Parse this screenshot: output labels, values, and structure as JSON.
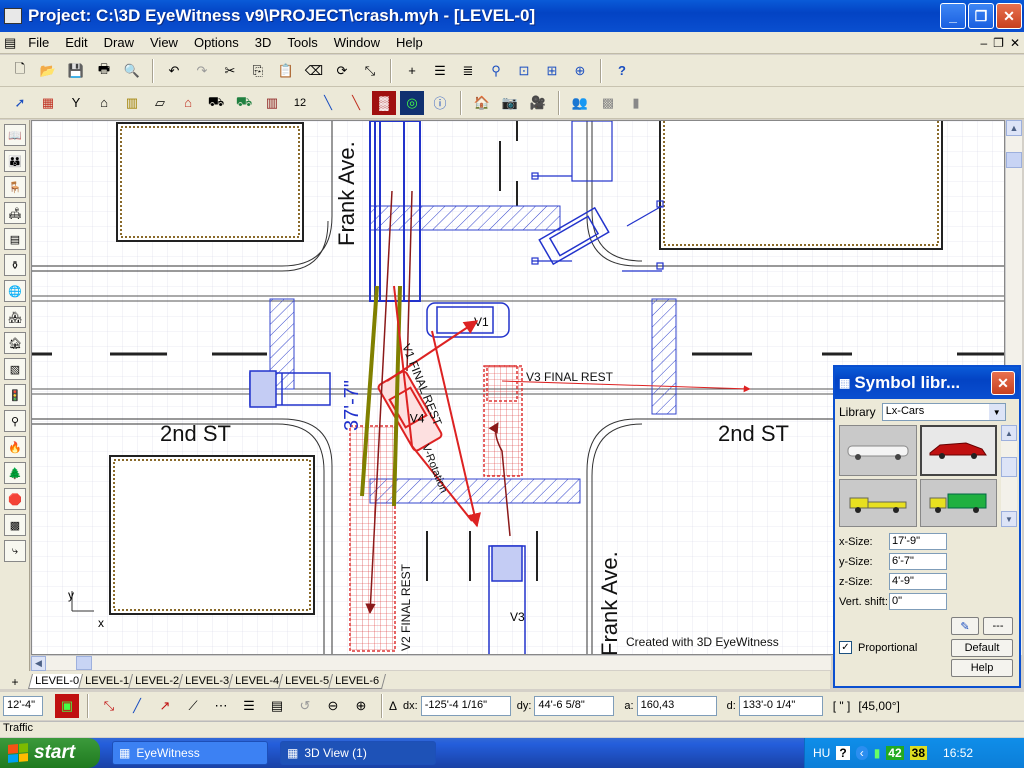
{
  "window": {
    "title": "Project: C:\\3D EyeWitness v9\\PROJECT\\crash.myh - [LEVEL-0]",
    "minimize": "_",
    "maximize": "❐",
    "close": "✕"
  },
  "menu": [
    "File",
    "Edit",
    "Draw",
    "View",
    "Options",
    "3D",
    "Tools",
    "Window",
    "Help"
  ],
  "mdi_controls": [
    "–",
    "❐",
    "✕"
  ],
  "toolbar1": [
    "new-icon",
    "open-icon",
    "save-icon",
    "print-icon",
    "print-preview-icon",
    "undo-icon",
    "redo-icon",
    "cut-icon",
    "copy-icon",
    "paste-icon",
    "erase-icon",
    "rotate-icon",
    "resize-icon",
    "snap-icon",
    "layers-icon",
    "layers-alt-icon",
    "zoom-icon",
    "zoom-window-icon",
    "zoom-extents-icon",
    "zoom-in-icon",
    "help-icon"
  ],
  "toolbar2": [
    "select-arrow-icon",
    "wall-icon",
    "tree-icon",
    "building-icon",
    "road-icon",
    "surface-icon",
    "house-icon",
    "vehicle-icon",
    "truck-icon",
    "fence-icon",
    "dimension-icon",
    "measure-icon",
    "line-icon",
    "texture-icon",
    "target-icon",
    "info-icon",
    "scene-icon",
    "camera-icon",
    "video-icon",
    "person-icon",
    "grid-icon",
    "post-icon"
  ],
  "dimension_label": "12",
  "left_tools": [
    "book-icon",
    "people-icon",
    "chair-icon",
    "furniture-icon",
    "bench-icon",
    "sink-icon",
    "globe-icon",
    "house-icon",
    "barn-icon",
    "roof-icon",
    "traffic-light-icon",
    "gun-icon",
    "fire-icon",
    "tree-icon",
    "sign-icon",
    "pattern-icon",
    "connector-icon"
  ],
  "map": {
    "street_north": "Frank Ave.",
    "street_south": "Frank Ave.",
    "street_west": "2nd ST",
    "street_east": "2nd ST",
    "label_v1": "V1",
    "label_v3": "V3",
    "label_v4": "V4",
    "v3_final_rest": "V3 FINAL REST",
    "v2_final_rest": "V2 FINAL REST",
    "v1_final_rest": "V1 FINAL REST",
    "v_rotation": "V-Rotation",
    "dimension": "37'-7\"",
    "watermark": "Created with 3D EyeWitness",
    "axis_x": "x",
    "axis_y": "y"
  },
  "tabs": {
    "plus": "+",
    "items": [
      "LEVEL-0",
      "LEVEL-1",
      "LEVEL-2",
      "LEVEL-3",
      "LEVEL-4",
      "LEVEL-5",
      "LEVEL-6"
    ]
  },
  "status": {
    "scale": "12'-4\"",
    "delta": "Δ",
    "dx_label": "dx:",
    "dx_value": "-125'-4 1/16\"",
    "dy_label": "dy:",
    "dy_value": "44'-6 5/8\"",
    "a_label": "a:",
    "a_value": "160,43",
    "d_label": "d:",
    "d_value": "133'-0 1/4\"",
    "unit": "[ \" ]",
    "angle": "[45,00°]",
    "bottom_text": "Traffic"
  },
  "symbol_panel": {
    "title": "Symbol libr...",
    "library_label": "Library",
    "library_value": "Lx-Cars",
    "x_size_label": "x-Size:",
    "x_size_value": "17'-9\"",
    "y_size_label": "y-Size:",
    "y_size_value": "6'-7\"",
    "z_size_label": "z-Size:",
    "z_size_value": "4'-9\"",
    "vert_shift_label": "Vert. shift:",
    "vert_shift_value": "0\"",
    "proportional_label": "Proportional",
    "proportional_checked": "✓",
    "default_button": "Default",
    "help_button": "Help",
    "more_button": "---"
  },
  "taskbar": {
    "start": "start",
    "items": [
      "EyeWitness",
      "3D View (1)"
    ],
    "lang": "HU",
    "tray_num1": "42",
    "tray_num2": "38",
    "clock": "16:52"
  },
  "colors": {
    "accent": "#0a4fd0",
    "road_blue": "#2233cc",
    "vehicle_red": "#dd2222",
    "path_dark": "#8b1a1a",
    "tire_olive": "#808000"
  }
}
